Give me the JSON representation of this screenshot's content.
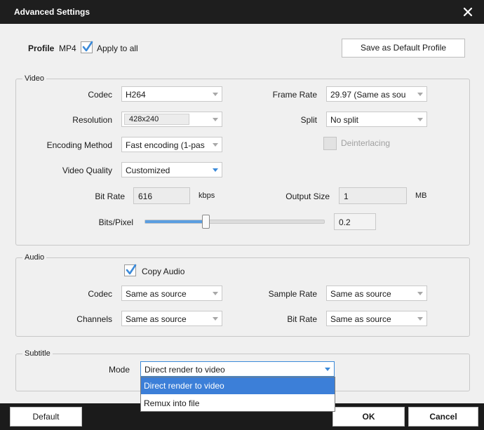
{
  "window": {
    "title": "Advanced Settings"
  },
  "profile": {
    "label": "Profile",
    "value": "MP4",
    "apply_all_label": "Apply to all",
    "apply_all_checked": true,
    "save_default_label": "Save as Default Profile"
  },
  "video": {
    "legend": "Video",
    "codec_label": "Codec",
    "codec_value": "H264",
    "frame_rate_label": "Frame Rate",
    "frame_rate_value": "29.97 (Same as sou",
    "resolution_label": "Resolution",
    "resolution_value": "428x240",
    "split_label": "Split",
    "split_value": "No split",
    "encoding_label": "Encoding Method",
    "encoding_value": "Fast encoding (1-pas",
    "deinterlacing_label": "Deinterlacing",
    "deinterlacing_checked": false,
    "quality_label": "Video Quality",
    "quality_value": "Customized",
    "bitrate_label": "Bit Rate",
    "bitrate_value": "616",
    "bitrate_unit": "kbps",
    "output_size_label": "Output Size",
    "output_size_value": "1",
    "output_size_unit": "MB",
    "bits_pixel_label": "Bits/Pixel",
    "bits_pixel_value": "0.2",
    "bits_pixel_slider_fraction": 0.34
  },
  "audio": {
    "legend": "Audio",
    "copy_audio_label": "Copy Audio",
    "copy_audio_checked": true,
    "codec_label": "Codec",
    "codec_value": "Same as source",
    "sample_rate_label": "Sample Rate",
    "sample_rate_value": "Same as source",
    "channels_label": "Channels",
    "channels_value": "Same as source",
    "bitrate_label": "Bit Rate",
    "bitrate_value": "Same as source"
  },
  "subtitle": {
    "legend": "Subtitle",
    "mode_label": "Mode",
    "mode_value": "Direct render to video",
    "options": [
      "Direct render to video",
      "Remux into file"
    ]
  },
  "footer": {
    "default_label": "Default",
    "ok_label": "OK",
    "cancel_label": "Cancel"
  },
  "colors": {
    "accent": "#3c7fd8",
    "titlebar": "#1e1e1e",
    "panel": "#f0f0f0"
  }
}
